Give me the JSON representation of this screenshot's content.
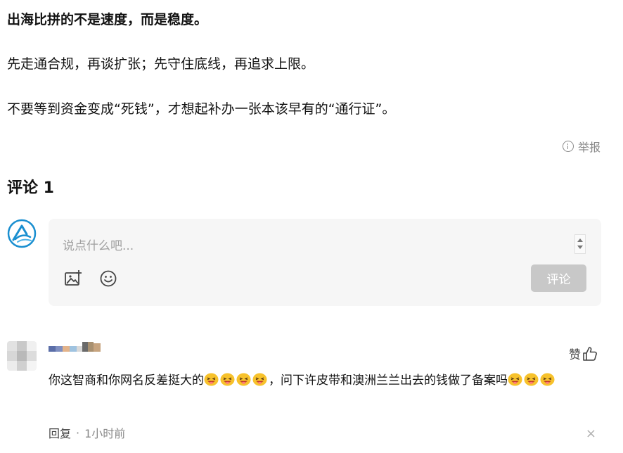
{
  "article": {
    "heading": "出海比拼的不是速度，而是稳度。",
    "para1": "先走通合规，再谈扩张；先守住底线，再追求上限。",
    "para2": "不要等到资金变成“死钱”，才想起补办一张本该早有的“通行证”。",
    "report_label": "举报"
  },
  "comments": {
    "title": "评论 1",
    "input_placeholder": "说点什么吧...",
    "submit_label": "评论",
    "items": [
      {
        "like_label": "赞",
        "text_part1": "你这智商和你网名反差挺大的",
        "text_part2": "，问下许皮带和澳洲兰兰出去的钱做了备案吗",
        "reply_label": "回复",
        "separator": "·",
        "time": "1小时前",
        "close_glyph": "×"
      }
    ]
  },
  "colors": {
    "accent_logo": "#1a8fd0",
    "submit_disabled": "#c8c8c8",
    "editor_bg": "#f6f6f6"
  },
  "icons": [
    "info-icon",
    "image-upload-icon",
    "emoji-icon",
    "thumbs-up-icon",
    "close-icon",
    "grin-emoji"
  ]
}
